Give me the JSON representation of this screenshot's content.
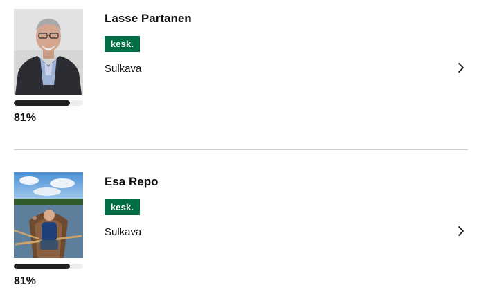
{
  "candidates": [
    {
      "name": "Lasse Partanen",
      "party": "kesk.",
      "municipality": "Sulkava",
      "match_percent_label": "81%",
      "match_fraction": 0.81
    },
    {
      "name": "Esa Repo",
      "party": "kesk.",
      "municipality": "Sulkava",
      "match_percent_label": "81%",
      "match_fraction": 0.81
    }
  ],
  "colors": {
    "party_badge": "#006e44",
    "match_bar": "#222222",
    "match_track": "#eeeeee",
    "divider": "#cfcfcf"
  },
  "icons": {
    "open_candidate": "chevron-right-icon"
  }
}
